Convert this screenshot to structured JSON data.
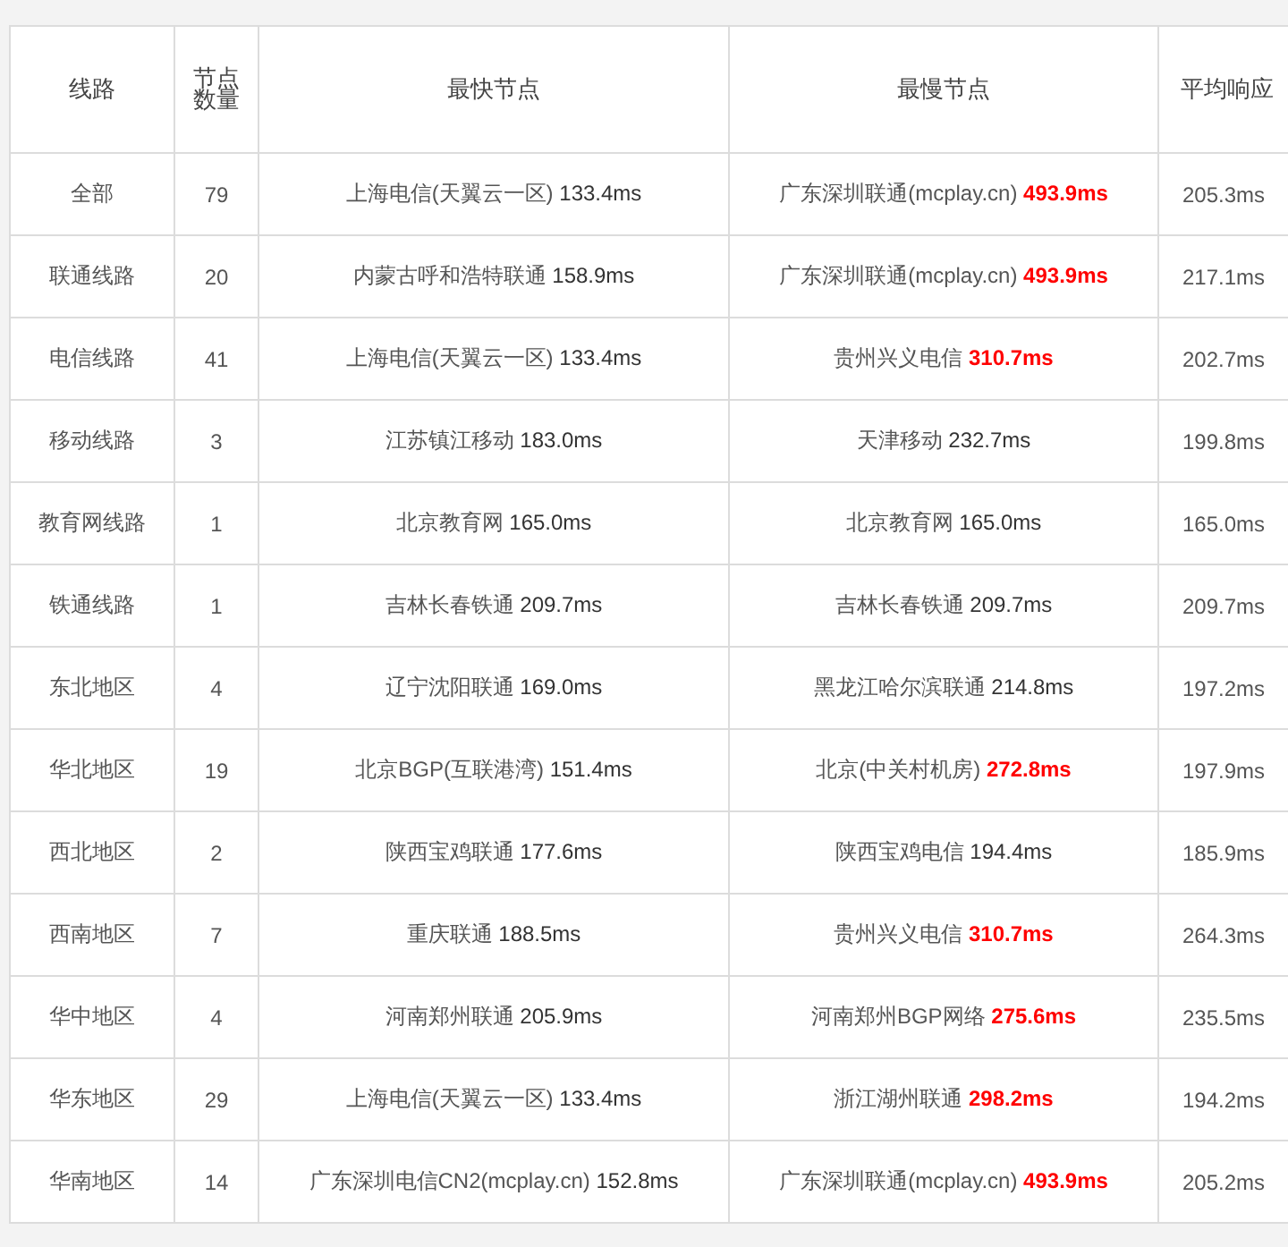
{
  "table": {
    "columns": [
      "线路",
      "节点数量",
      "最快节点",
      "最慢节点",
      "平均响应"
    ],
    "rows": [
      {
        "line": "全部",
        "count": "79",
        "fastest": {
          "name": "上海电信(天翼云一区)",
          "time": "133.4ms"
        },
        "slowest": {
          "name": "广东深圳联通(mcplay.cn)",
          "time": "493.9ms",
          "highlight": true
        },
        "average": "205.3ms"
      },
      {
        "line": "联通线路",
        "count": "20",
        "fastest": {
          "name": "内蒙古呼和浩特联通",
          "time": "158.9ms"
        },
        "slowest": {
          "name": "广东深圳联通(mcplay.cn)",
          "time": "493.9ms",
          "highlight": true
        },
        "average": "217.1ms"
      },
      {
        "line": "电信线路",
        "count": "41",
        "fastest": {
          "name": "上海电信(天翼云一区)",
          "time": "133.4ms"
        },
        "slowest": {
          "name": "贵州兴义电信",
          "time": "310.7ms",
          "highlight": true
        },
        "average": "202.7ms"
      },
      {
        "line": "移动线路",
        "count": "3",
        "fastest": {
          "name": "江苏镇江移动",
          "time": "183.0ms"
        },
        "slowest": {
          "name": "天津移动",
          "time": "232.7ms",
          "highlight": false
        },
        "average": "199.8ms"
      },
      {
        "line": "教育网线路",
        "count": "1",
        "fastest": {
          "name": "北京教育网",
          "time": "165.0ms"
        },
        "slowest": {
          "name": "北京教育网",
          "time": "165.0ms",
          "highlight": false
        },
        "average": "165.0ms"
      },
      {
        "line": "铁通线路",
        "count": "1",
        "fastest": {
          "name": "吉林长春铁通",
          "time": "209.7ms"
        },
        "slowest": {
          "name": "吉林长春铁通",
          "time": "209.7ms",
          "highlight": false
        },
        "average": "209.7ms"
      },
      {
        "line": "东北地区",
        "count": "4",
        "fastest": {
          "name": "辽宁沈阳联通",
          "time": "169.0ms"
        },
        "slowest": {
          "name": "黑龙江哈尔滨联通",
          "time": "214.8ms",
          "highlight": false
        },
        "average": "197.2ms"
      },
      {
        "line": "华北地区",
        "count": "19",
        "fastest": {
          "name": "北京BGP(互联港湾)",
          "time": "151.4ms"
        },
        "slowest": {
          "name": "北京(中关村机房)",
          "time": "272.8ms",
          "highlight": true
        },
        "average": "197.9ms"
      },
      {
        "line": "西北地区",
        "count": "2",
        "fastest": {
          "name": "陕西宝鸡联通",
          "time": "177.6ms"
        },
        "slowest": {
          "name": "陕西宝鸡电信",
          "time": "194.4ms",
          "highlight": false
        },
        "average": "185.9ms"
      },
      {
        "line": "西南地区",
        "count": "7",
        "fastest": {
          "name": "重庆联通",
          "time": "188.5ms"
        },
        "slowest": {
          "name": "贵州兴义电信",
          "time": "310.7ms",
          "highlight": true
        },
        "average": "264.3ms"
      },
      {
        "line": "华中地区",
        "count": "4",
        "fastest": {
          "name": "河南郑州联通",
          "time": "205.9ms"
        },
        "slowest": {
          "name": "河南郑州BGP网络",
          "time": "275.6ms",
          "highlight": true
        },
        "average": "235.5ms"
      },
      {
        "line": "华东地区",
        "count": "29",
        "fastest": {
          "name": "上海电信(天翼云一区)",
          "time": "133.4ms"
        },
        "slowest": {
          "name": "浙江湖州联通",
          "time": "298.2ms",
          "highlight": true
        },
        "average": "194.2ms"
      },
      {
        "line": "华南地区",
        "count": "14",
        "fastest": {
          "name": "广东深圳电信CN2(mcplay.cn)",
          "time": "152.8ms"
        },
        "slowest": {
          "name": "广东深圳联通(mcplay.cn)",
          "time": "493.9ms",
          "highlight": true
        },
        "average": "205.2ms"
      }
    ]
  }
}
